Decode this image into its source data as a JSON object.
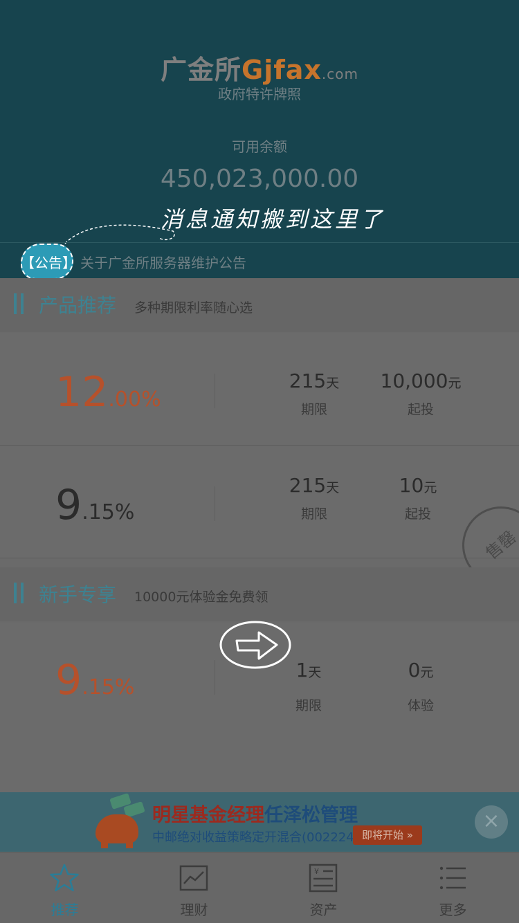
{
  "header": {
    "logo_text": "广金所",
    "logo_latin": "Gjfax",
    "logo_domain": ".com",
    "license": "政府特许牌照",
    "balance_label": "可用余额",
    "balance_value": "450,023,000.00",
    "hint": "消息通知搬到这里了"
  },
  "notice": {
    "tag": "【公告】",
    "text": "关于广金所服务器维护公告"
  },
  "sections": [
    {
      "title": "产品推荐",
      "subtitle": "多种期限利率随心选"
    },
    {
      "title": "新手专享",
      "subtitle": "10000元体验金免费领"
    }
  ],
  "products": [
    {
      "rate_int": "12",
      "rate_dec": ".00%",
      "term_value": "215",
      "term_unit": "天",
      "term_label": "期限",
      "min_value": "10,000",
      "min_unit": "元",
      "min_label": "起投"
    },
    {
      "rate_int": "9",
      "rate_dec": ".15%",
      "term_value": "215",
      "term_unit": "天",
      "term_label": "期限",
      "min_value": "10",
      "min_unit": "元",
      "min_label": "起投",
      "stamp": "售罄"
    }
  ],
  "newbie_product": {
    "rate_int": "9",
    "rate_dec": ".15%",
    "term_value": "1",
    "term_unit": "天",
    "term_label": "期限",
    "exp_value": "0",
    "exp_unit": "元",
    "exp_label": "体验"
  },
  "banner": {
    "title_red": "明星基金经理",
    "title_blue": "任泽松管理",
    "subtitle": "中邮绝对收益策略定开混合(002224)",
    "button": "即将开始 »",
    "close": "×"
  },
  "tabbar": [
    {
      "label": "推荐",
      "icon": "star-icon",
      "active": true
    },
    {
      "label": "理财",
      "icon": "chart-icon",
      "active": false
    },
    {
      "label": "资产",
      "icon": "ledger-icon",
      "active": false
    },
    {
      "label": "更多",
      "icon": "list-icon",
      "active": false
    }
  ],
  "colors": {
    "header_bg": "#17444e",
    "accent": "#3d8291",
    "rate_orange": "#b6512b",
    "tab_active": "#2a7d97"
  }
}
